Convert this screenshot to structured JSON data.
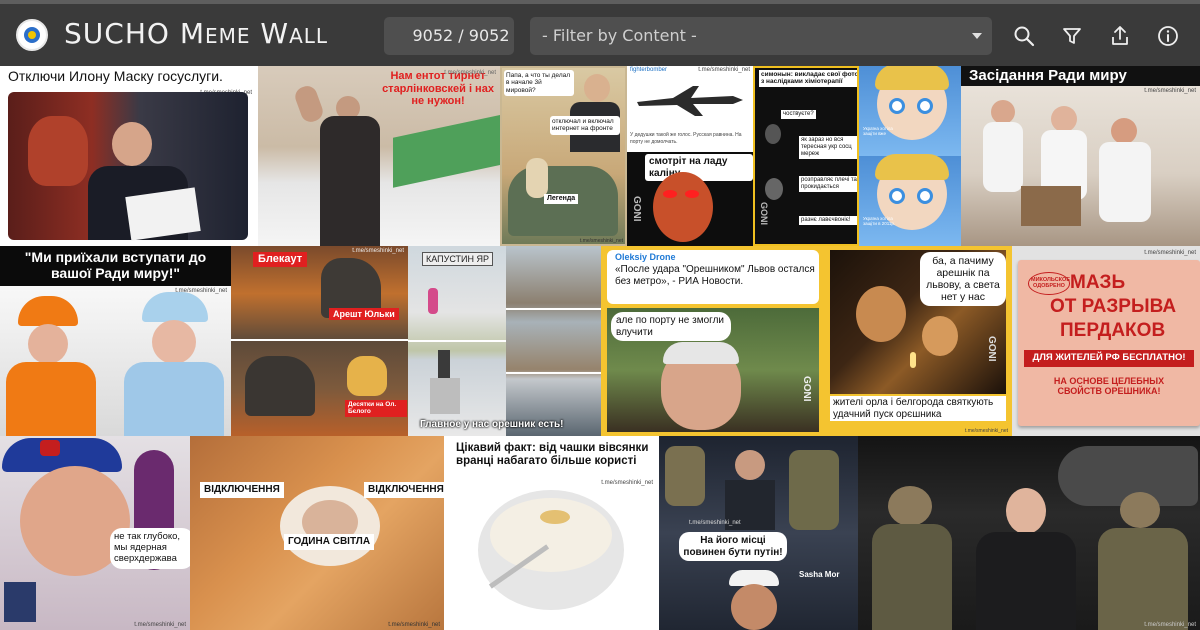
{
  "header": {
    "title": "SUCHO Meme Wall",
    "counter": "9052 / 9052",
    "filter_placeholder": "- Filter by Content -"
  },
  "tiles": {
    "t1": {
      "caption": "Отключи Илону Маску госуслуги.",
      "watermark": "t.me/smeshinki_net"
    },
    "t2": {
      "caption": "Нам ентот тирнет старлінковскей і нах не нужон!",
      "watermark": "t.me/smeshinki_net"
    },
    "t3": {
      "bubble1": "Папа, а что ты делал в начале 3й мировой?",
      "bubble2": "отключал и включал интернет на фронте",
      "label": "Легенда",
      "watermark": "t.me/smeshinki_net"
    },
    "t4": {
      "top": "fighterbomber",
      "watermark": "t.me/smeshinki_net",
      "small": "У дедушки такой же голос. Русская равнина. На порту не домолчать.",
      "caption": "смотріт на ладу каліну",
      "brand": "GONI"
    },
    "t5": {
      "title": "симонын: викладає свої фото з наслідками хіміотерапії",
      "q1": "чоствуєте?",
      "q2": "як зараз но вся тересная укр сосц мереж",
      "q3": "розправляє плечі та прокидається",
      "q4": "разнє лавєчвоніє!",
      "brand": "GONI"
    },
    "t6": {
      "small1": "Україна хотіла защіти вже",
      "small2": "Україна хотіла защіти в 2011р."
    },
    "t7": {
      "caption": "Засідання Ради миру",
      "watermark": "t.me/smeshinki_net"
    },
    "t8": {
      "caption": "\"Ми приїхали вступати до вашої Ради миру!\"",
      "watermark": "t.me/smeshinki_net"
    },
    "t9": {
      "label1": "Блекаут",
      "label2": "Арешт Юльки",
      "label3": "Десятки на Ол. Бєлого",
      "watermark": "t.me/smeshinki_net"
    },
    "t10": {
      "sign": "КАПУСТИН ЯР",
      "caption": "Главное у нас орешник есть!"
    },
    "t11": {
      "author": "Oleksiy Drone",
      "quote": "«После удара \"Орешником\" Львов остался без метро», - РИА Новости.",
      "bubble": "але по порту не змогли влучити",
      "brand": "GONI"
    },
    "t12": {
      "bubble": "ба, а пачиму арешнік па львову, а света нет у нас",
      "caption": "жителі орла і белгорода святкують удачний пуск орєшника",
      "brand": "GONI",
      "watermark": "t.me/smeshinki_net"
    },
    "t13": {
      "top": "МИКОЛЬСКОЕ ОДОБРЕНО",
      "main1": "МАЗЬ",
      "main2": "ОТ РАЗРЫВА",
      "main3": "ПЕРДАКОВ",
      "band": "ДЛЯ ЖИТЕЛЕЙ РФ БЕСПЛАТНО!",
      "footer": "НА ОСНОВЕ ЦЕЛЕБНЫХ СВОЙСТВ ОРЕШНИКА!",
      "watermark": "t.me/smeshinki_net"
    },
    "t14": {
      "bubble": "не так глубоко, мы ядерная сверхдержава",
      "watermark": "t.me/smeshinki_net"
    },
    "t15": {
      "label1": "ВІДКЛЮЧЕННЯ",
      "label2": "ВІДКЛЮЧЕННЯ",
      "label3": "ГОДИНА СВІТЛА",
      "watermark": "t.me/smeshinki_net"
    },
    "t16": {
      "caption": "Цікавий факт: від чашки вівсянки вранці набагато більше користі",
      "watermark": "t.me/smeshinki_net"
    },
    "t17": {
      "caption": "На його місці повинен бути путін!",
      "credit": "Sasha Mor",
      "watermark": "t.me/smeshinki_net"
    },
    "t18": {
      "watermark": "t.me/smeshinki_net"
    }
  }
}
